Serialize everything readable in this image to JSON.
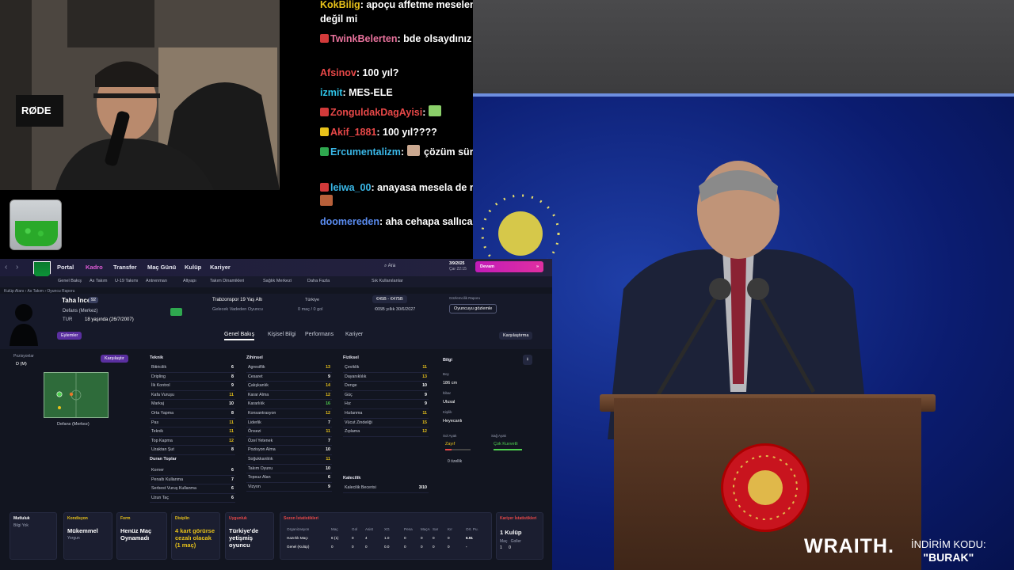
{
  "chat": [
    {
      "user": "KokBilig",
      "color": "#e8c21a",
      "text": "apoçu affetme meselen var değil mi",
      "badge": ""
    },
    {
      "user": "TwinkBelerten",
      "color": "#e8729c",
      "text": "bde olsaydınız aq",
      "badge": "#d23a3a"
    },
    {
      "user": "Afsinov",
      "color": "#e84848",
      "text": "100 yıl?",
      "badge": ""
    },
    {
      "user": "izmit",
      "color": "#2fc4e8",
      "text": "MES-ELE",
      "badge": ""
    },
    {
      "user": "ZonguldakDagAyisi",
      "color": "#e84848",
      "text": "",
      "badge": "#d23a3a"
    },
    {
      "user": "Akif_1881",
      "color": "#e84848",
      "text": "100 yıl????",
      "badge": "#e8c21a"
    },
    {
      "user": "Ercumentalizm",
      "color": "#3ab8e8",
      "text": "çözüm süreci",
      "badge": "#2fa84f"
    },
    {
      "user": "leiwa_00",
      "color": "#3ab8e8",
      "text": "anayasa mesela de mi",
      "badge": "#d23a3a"
    },
    {
      "user": "doomereden",
      "color": "#5a8cf0",
      "text": "aha cehapa sallıcak",
      "badge": ""
    }
  ],
  "promo": {
    "brand": "WRAITH.",
    "line1": "İNDİRİM KODU:",
    "code": "\"BURAK\""
  },
  "game": {
    "nav": [
      "Portal",
      "Kadro",
      "Transfer",
      "Maç Günü",
      "Kulüp",
      "Kariyer"
    ],
    "subnav": [
      "Genel Bakış",
      "As Takım",
      "U-19 Takımı",
      "Antrenman",
      "Altyapı",
      "Takım Dinamikleri",
      "Sağlık Merkezi",
      "Daha Fazla"
    ],
    "search": "Ara",
    "date": "3/9/2025",
    "day": "Çar 22:15",
    "continue": "Devam",
    "manager_menu": "Sık Kullanılanlar",
    "breadcrumb": "Kulüp Alanı  ›  As Takım  ›  Oyuncu Raporu",
    "player": {
      "name": "Taha İnce",
      "ca": "92",
      "position": "Defans (Merkez)",
      "nation": "TUR",
      "age": "18 yaşında (26/7/2007)",
      "club": "Trabzonspor 19 Yaş Altı",
      "status": "Gelecek Vadeden Oyuncu",
      "country": "Türkiye",
      "apps": "0 maç / 0 gol",
      "value": "€45B - €475B",
      "wage": "€65B yıllık 30/6/2027",
      "report_label": "Gözlemcilik Raporu",
      "watch": "Oyuncuyu gözlemle",
      "actions": "Eylemler",
      "compare": "Karşılaştırma"
    },
    "tabs": [
      "Genel Bakış",
      "Kişisel Bilgi",
      "Performans",
      "Kariyer"
    ],
    "positions_label": "Pozisyonlar",
    "positions_value": "D (M)",
    "pitch_caption": "Defans (Merkez)",
    "compare_btn": "Karşılaştır",
    "technical_title": "Teknik",
    "technical": [
      [
        "Bitiricilik",
        "6"
      ],
      [
        "Dripling",
        "8"
      ],
      [
        "İlk Kontrol",
        "9"
      ],
      [
        "Kafa Vuruşu",
        "11"
      ],
      [
        "Markaj",
        "10"
      ],
      [
        "Orta Yapma",
        "8"
      ],
      [
        "Pas",
        "11"
      ],
      [
        "Teknik",
        "11"
      ],
      [
        "Top Kapma",
        "12"
      ],
      [
        "Uzaktan Şut",
        "8"
      ]
    ],
    "setpieces_title": "Duran Toplar",
    "setpieces": [
      [
        "Korner",
        "6"
      ],
      [
        "Penaltı Kullanma",
        "7"
      ],
      [
        "Serbest Vuruş Kullanma",
        "6"
      ],
      [
        "Uzun Taç",
        "6"
      ]
    ],
    "mental_title": "Zihinsel",
    "mental": [
      [
        "Agresiflik",
        "13"
      ],
      [
        "Cesaret",
        "9"
      ],
      [
        "Çalışkanlık",
        "14"
      ],
      [
        "Karar Alma",
        "12"
      ],
      [
        "Kararlılık",
        "16"
      ],
      [
        "Konsantrasyon",
        "12"
      ],
      [
        "Liderlik",
        "7"
      ],
      [
        "Önsezi",
        "11"
      ],
      [
        "Özel Yetenek",
        "7"
      ],
      [
        "Pozisyon Alma",
        "10"
      ],
      [
        "Soğukkanlılık",
        "11"
      ],
      [
        "Takım Oyunu",
        "10"
      ],
      [
        "Topsuz Alan",
        "6"
      ],
      [
        "Vizyon",
        "9"
      ]
    ],
    "physical_title": "Fiziksel",
    "physical": [
      [
        "Çeviklik",
        "11"
      ],
      [
        "Dayanıklılık",
        "13"
      ],
      [
        "Denge",
        "10"
      ],
      [
        "Güç",
        "9"
      ],
      [
        "Hız",
        "9"
      ],
      [
        "Hızlanma",
        "11"
      ],
      [
        "Vücut Zindeliği",
        "15"
      ],
      [
        "Zıplama",
        "12"
      ]
    ],
    "goalkeeping_title": "Kalecilik",
    "goalkeeping": [
      [
        "Kalecilik Becerisi",
        "3/10"
      ]
    ],
    "info": {
      "title": "Bilgi",
      "height_label": "Boy",
      "height": "186 cm",
      "nation_label": "İtibar",
      "nation": "Ulusal",
      "personality_label": "Kişilik",
      "personality": "Heyecanlı",
      "left_foot_label": "Sol Ayak",
      "left_foot": "Zayıf",
      "right_foot_label": "Sağ Ayak",
      "right_foot": "Çok Kuvvetli",
      "traits": "0 özellik"
    },
    "cards": [
      {
        "h": "Mutluluk",
        "t": "",
        "s": "Bilgi Yok",
        "color": "#c8ccd8"
      },
      {
        "h": "Kondisyon",
        "t": "Mükemmel",
        "s": "Yorgun",
        "color": "#4fd04f"
      },
      {
        "h": "Form",
        "t": "Henüz Maç Oynamadı",
        "s": "",
        "color": "#e8c21a"
      },
      {
        "h": "Disiplin",
        "t": "4 kart görürse cezalı olacak (1 maç)",
        "s": "",
        "color": "#e8c21a"
      },
      {
        "h": "Uygunluk",
        "t": "Türkiye'de yetişmiş oyuncu",
        "s": "",
        "color": "#e84848"
      }
    ],
    "season_stats": {
      "title": "Sezon İstatistikleri",
      "headers": [
        "Organizasyon",
        "Maç",
        "Gol",
        "Asist",
        "XG",
        "Pena",
        "MaçA",
        "Sar",
        "Kır",
        "Ort. Pu."
      ],
      "rows": [
        [
          "Hazırlık Maçı",
          "6 (1)",
          "0",
          "4",
          "1.0",
          "0",
          "0",
          "0",
          "0",
          "6.91"
        ],
        [
          "Genel (Kulüp)",
          "0",
          "0",
          "0",
          "0.0",
          "0",
          "0",
          "0",
          "0",
          "-"
        ]
      ]
    },
    "career": {
      "title": "Kariyer İstatistikleri",
      "clubs": "1 Kulüp",
      "apps_label": "Maç",
      "goals_label": "Goller",
      "apps": "1",
      "goals": "0"
    }
  }
}
